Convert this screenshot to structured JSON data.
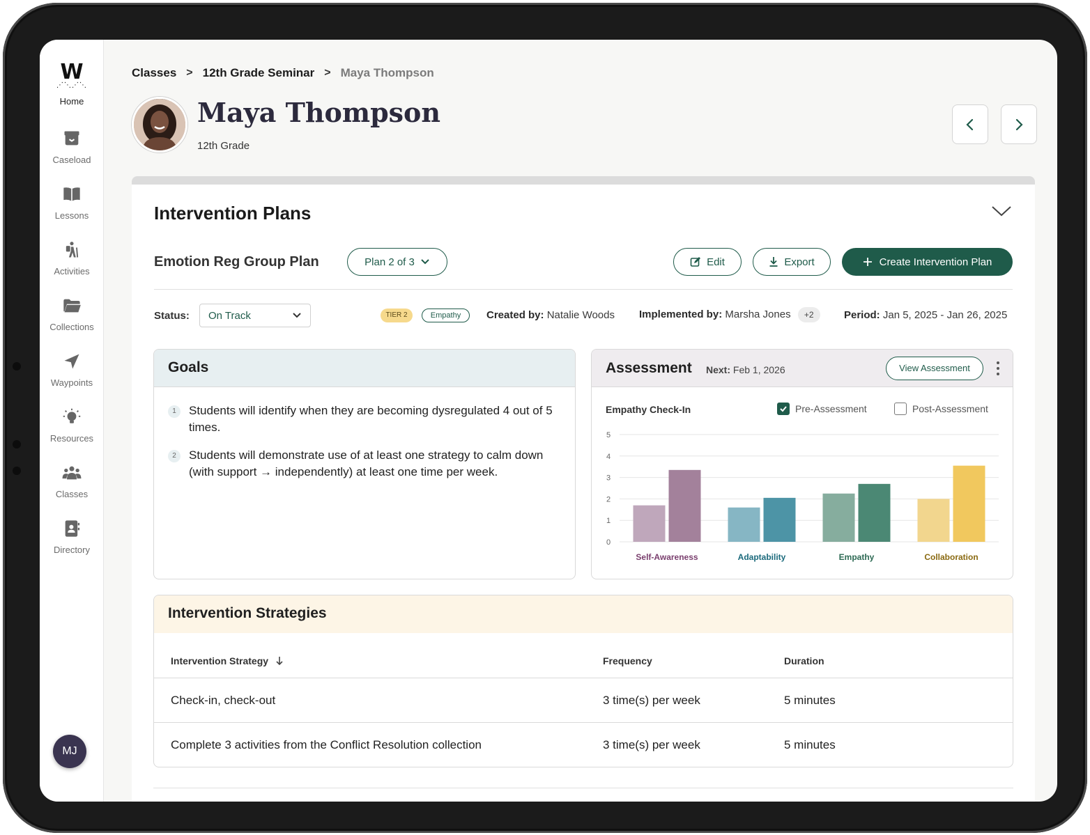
{
  "sidebar": {
    "logo": "W",
    "items": [
      {
        "label": "Home",
        "icon": "home-logo"
      },
      {
        "label": "Caseload",
        "icon": "box-icon"
      },
      {
        "label": "Lessons",
        "icon": "book-icon"
      },
      {
        "label": "Activities",
        "icon": "hiker-icon"
      },
      {
        "label": "Collections",
        "icon": "folder-icon"
      },
      {
        "label": "Waypoints",
        "icon": "navigation-arrow-icon"
      },
      {
        "label": "Resources",
        "icon": "lightbulb-icon"
      },
      {
        "label": "Classes",
        "icon": "people-icon"
      },
      {
        "label": "Directory",
        "icon": "contact-book-icon"
      }
    ],
    "user_initials": "MJ"
  },
  "breadcrumb": [
    "Classes",
    "12th Grade Seminar",
    "Maya Thompson"
  ],
  "student": {
    "name": "Maya Thompson",
    "grade": "12th Grade"
  },
  "interventions": {
    "title": "Intervention Plans",
    "plan_name": "Emotion Reg Group Plan",
    "plan_selector": "Plan 2 of 3",
    "edit_label": "Edit",
    "export_label": "Export",
    "create_label": "Create Intervention Plan",
    "status_label": "Status:",
    "status_value": "On Track",
    "tier_tag": "TIER 2",
    "empathy_tag": "Empathy",
    "created_by_label": "Created by:",
    "created_by": "Natalie Woods",
    "implemented_by_label": "Implemented by:",
    "implemented_by": "Marsha Jones",
    "implemented_extra": "+2",
    "period_label": "Period:",
    "period": "Jan 5, 2025 - Jan 26, 2025"
  },
  "goals": {
    "title": "Goals",
    "items": [
      {
        "num": "1",
        "text": "Students will identify when they are becoming dysregulated 4 out of 5 times."
      },
      {
        "num": "2",
        "text": "Students will demonstrate use of at least one strategy to calm down (with support → independently) at least one time per week."
      }
    ]
  },
  "assessment": {
    "title": "Assessment",
    "next_label": "Next:",
    "next_date": "Feb 1, 2026",
    "view_label": "View Assessment",
    "chart_title": "Empathy Check-In",
    "legend_pre": "Pre-Assessment",
    "legend_post": "Post-Assessment"
  },
  "chart_data": {
    "type": "bar",
    "categories": [
      "Self-Awareness",
      "Adaptability",
      "Empathy",
      "Collaboration"
    ],
    "series": [
      {
        "name": "Pre-Assessment",
        "values": [
          1.7,
          1.6,
          2.25,
          2.0
        ]
      },
      {
        "name": "Post-Assessment",
        "values": [
          3.35,
          2.05,
          2.7,
          3.55
        ]
      }
    ],
    "ylim": [
      0,
      5
    ],
    "yticks": [
      "0",
      "1",
      "2",
      "3",
      "4",
      "5"
    ],
    "grid": true,
    "colors": {
      "pre": [
        "#bfa7bb",
        "#86b6c4",
        "#86ad9e",
        "#f2d68e"
      ],
      "post": [
        "#a3819b",
        "#4d94a6",
        "#4b8874",
        "#f1c85e"
      ],
      "labels": [
        "#7a3f6e",
        "#1b6a7c",
        "#2d6a54",
        "#8a6a12"
      ]
    }
  },
  "strategies": {
    "title": "Intervention Strategies",
    "columns": [
      "Intervention Strategy",
      "Frequency",
      "Duration"
    ],
    "rows": [
      [
        "Check-in, check-out",
        "3 time(s) per week",
        "5 minutes"
      ],
      [
        "Complete 3 activities from the Conflict Resolution collection",
        "3 time(s) per week",
        "5 minutes"
      ]
    ]
  },
  "colors": {
    "accent": "#1f5b4a"
  }
}
